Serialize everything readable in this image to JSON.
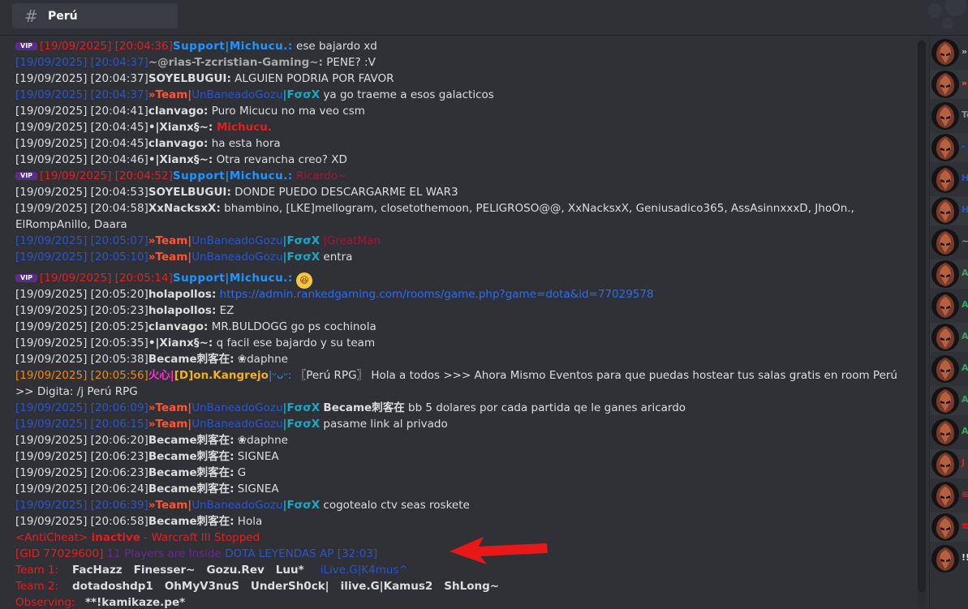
{
  "header": {
    "channel_hash": "#",
    "channel_name": "Perú"
  },
  "chat": {
    "lines": [
      {
        "vip": "VIP",
        "ts": "[19/09/2025] [20:04:36]",
        "name": "Support|Michucu.:",
        "msg": " ese bajardo xd"
      },
      {
        "ts": "[19/09/2025] [20:04:37]",
        "name": "~@rias-T-zcristian-Gaming~:",
        "msg": " PENE? :V"
      },
      {
        "ts": "[19/09/2025] [20:04:37]",
        "name": "SOYELBUGUI:",
        "msg": " ALGUIEN PODRIA POR FAVOR"
      },
      {
        "ts": "[19/09/2025] [20:04:37]",
        "team": "»Team|",
        "name": "UnBaneadoGozu",
        "tag": "|FσσX",
        "msg": " ya go traeme a esos galacticos"
      },
      {
        "ts": "[19/09/2025] [20:04:41]",
        "name": "clanvago:",
        "msg": " Puro Micucu no ma veo csm"
      },
      {
        "ts": "[19/09/2025] [20:04:45]",
        "name": "•|Xianx§~:",
        "msg": " Michucu."
      },
      {
        "ts": "[19/09/2025] [20:04:45]",
        "name": "clanvago:",
        "msg": " ha esta hora"
      },
      {
        "ts": "[19/09/2025] [20:04:46]",
        "name": "•|Xianx§~:",
        "msg": " Otra revancha creo? XD"
      },
      {
        "vip": "VIP",
        "ts": "[19/09/2025] [20:04:52]",
        "name": "Support|Michucu.:",
        "msg": " Ricardo~"
      },
      {
        "ts": "[19/09/2025] [20:04:53]",
        "name": "SOYELBUGUI:",
        "msg": " DONDE PUEDO DESCARGARME EL WAR3"
      },
      {
        "ts": "[19/09/2025] [20:04:58]",
        "name": "XxNacksxX:",
        "msg": " bhambino, [LKE]mellogram, closetothemoon, PELIGROSO@@, XxNacksxX, Geniusadico365, AssAsinnxxxD, JhoOn., ElRompAnillo, Daara"
      },
      {
        "ts": "[19/09/2025] [20:05:07]",
        "team": "»Team|",
        "name": "UnBaneadoGozu",
        "tag": "|FσσX",
        "msg": " |GreatMan"
      },
      {
        "ts": "[19/09/2025] [20:05:10]",
        "team": "»Team|",
        "name": "UnBaneadoGozu",
        "tag": "|FσσX",
        "msg": " entra"
      },
      {
        "vip": "VIP",
        "ts": "[19/09/2025] [20:05:14]",
        "name": "Support|Michucu.:",
        "msg": "😆"
      },
      {
        "ts": "[19/09/2025] [20:05:20]",
        "name": "holapollos:",
        "msg": " https://admin.rankedgaming.com/rooms/game.php?game=dota&id=77029578"
      },
      {
        "ts": "[19/09/2025] [20:05:23]",
        "name": "holapollos:",
        "msg": " EZ"
      },
      {
        "ts": "[19/09/2025] [20:05:25]",
        "name": "clanvago:",
        "msg": " MR.BULDOGG go ps cochinola"
      },
      {
        "ts": "[19/09/2025] [20:05:35]",
        "name": "•|Xianx§~:",
        "msg": " q facil ese bajardo y su team"
      },
      {
        "ts": "[19/09/2025] [20:05:38]",
        "name": "Became刺客在:",
        "msg": " ❀daphne"
      },
      {
        "ts": "[19/09/2025] [20:05:56]",
        "pre": "火心|",
        "name": "[D]on.Kangrejo",
        "tag": "|ᵕᴗᵕ:",
        "msg": " 〖Perú RPG〗 Hola a todos >>> Ahora Mismo Eventos para que puedas hostear tus salas gratis en room Perú >> Digita: /j Perú RPG"
      },
      {
        "ts": "[19/09/2025] [20:06:09]",
        "team": "»Team|",
        "name": "UnBaneadoGozu",
        "tag": "|FσσX",
        "msg2": "Became刺客在",
        "msg": " bb 5 dolares por cada partida qe le ganes aricardo"
      },
      {
        "ts": "[19/09/2025] [20:06:15]",
        "team": "»Team|",
        "name": "UnBaneadoGozu",
        "tag": "|FσσX",
        "msg": " pasame link al privado"
      },
      {
        "ts": "[19/09/2025] [20:06:20]",
        "name": "Became刺客在:",
        "msg": " ❀daphne"
      },
      {
        "ts": "[19/09/2025] [20:06:23]",
        "name": "Became刺客在:",
        "msg": " SIGNEA"
      },
      {
        "ts": "[19/09/2025] [20:06:23]",
        "name": "Became刺客在:",
        "msg": " G"
      },
      {
        "ts": "[19/09/2025] [20:06:24]",
        "name": "Became刺客在:",
        "msg": " SIGNEA"
      },
      {
        "ts": "[19/09/2025] [20:06:39]",
        "team": "»Team|",
        "name": "UnBaneadoGozu",
        "tag": "|FσσX",
        "msg": " cogotealo ctv seas roskete"
      },
      {
        "ts": "[19/09/2025] [20:06:58]",
        "name": "Became刺客在:",
        "msg": " Hola"
      }
    ],
    "anticheat": {
      "prefix": "<AntiCheat>",
      "status": "inactive",
      "rest": " - Warcraft III Stopped"
    },
    "gid": {
      "id": "[GID 77029600]",
      "players": " 11 Players are Inside ",
      "game": "DOTA LEYENDAS AP [32:03]"
    },
    "team1": {
      "label": "Team 1:",
      "players": [
        "FacHazz",
        "Finesser~",
        "Gozu.Rev",
        "Luu*"
      ],
      "extra": "iLive.G|K4mus^"
    },
    "team2": {
      "label": "Team 2:",
      "players": [
        "dotadoshdp1",
        "OhMyV3nuS",
        "UnderSh0ck|",
        "ilive.G|Kamus2",
        "ShLong~"
      ]
    },
    "observing": {
      "label": "Observing:",
      "players": [
        "**!kamikaze.pe*"
      ]
    }
  },
  "members": [
    {
      "label": "»",
      "color": "#b9bbbe"
    },
    {
      "label": "»",
      "color": "#ff5533"
    },
    {
      "label": "To",
      "color": "#8e9297"
    },
    {
      "label": "-",
      "color": "#2a55c8"
    },
    {
      "label": "H",
      "color": "#2a55c8"
    },
    {
      "label": "H",
      "color": "#2a55c8"
    },
    {
      "label": "~",
      "color": "#8e9297"
    },
    {
      "label": "A",
      "color": "#3ba55c"
    },
    {
      "label": "A",
      "color": "#3ba55c"
    },
    {
      "label": "A",
      "color": "#3ba55c"
    },
    {
      "label": "A",
      "color": "#3ba55c"
    },
    {
      "label": "A",
      "color": "#3ba55c"
    },
    {
      "label": "A",
      "color": "#3ba55c"
    },
    {
      "label": "J",
      "color": "#e02020"
    },
    {
      "label": "≋",
      "color": "#e02020"
    },
    {
      "label": "≋",
      "color": "#e02020"
    },
    {
      "label": "!!",
      "color": "#dcddde"
    }
  ]
}
